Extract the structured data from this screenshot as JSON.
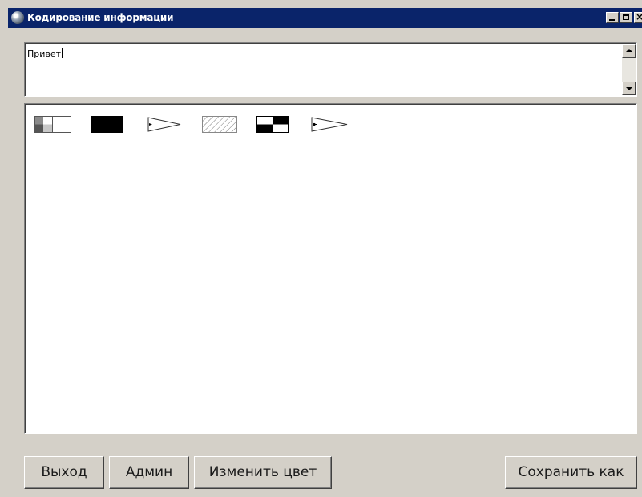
{
  "window": {
    "title": "Кодирование информации",
    "icon": "globe-icon"
  },
  "titlebar_buttons": {
    "minimize": "minimize-icon",
    "maximize": "maximize-icon",
    "close": "close-icon",
    "close_glyph": "×"
  },
  "editor": {
    "text": "Привет"
  },
  "canvas": {
    "glyphs": [
      "quadrant-block-icon",
      "solid-black-rectangle-icon",
      "triangle-flag-icon",
      "hatched-rectangle-icon",
      "checker-block-icon",
      "triangle-flag-dot-icon"
    ]
  },
  "buttons": {
    "exit": "Выход",
    "admin": "Админ",
    "change_color": "Изменить цвет",
    "save_as": "Сохранить как"
  }
}
